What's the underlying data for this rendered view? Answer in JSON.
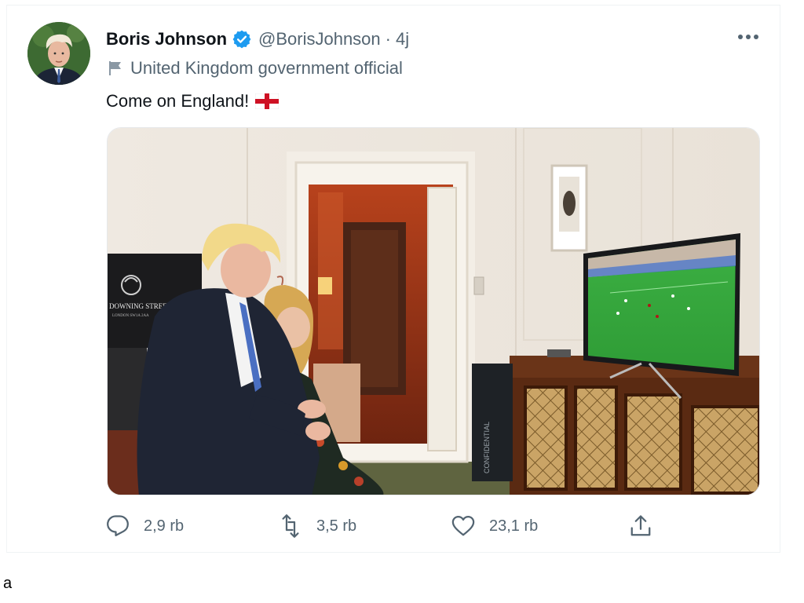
{
  "tweet": {
    "display_name": "Boris Johnson",
    "handle": "@BorisJohnson",
    "separator": "·",
    "timestamp": "4j",
    "label": "United Kingdom government official",
    "text": "Come on England!",
    "more_icon": "more-horizontal-icon",
    "verified_color": "#1d9bf0",
    "photo": {
      "sign_text": "DOWNING STREET",
      "sign_subtext": "LONDON SW1A 2AA",
      "cabinet_text": "CONFIDENTIAL"
    },
    "actions": {
      "reply": {
        "icon": "reply-icon",
        "count": "2,9 rb"
      },
      "retweet": {
        "icon": "retweet-icon",
        "count": "3,5 rb"
      },
      "like": {
        "icon": "heart-icon",
        "count": "23,1 rb"
      },
      "share": {
        "icon": "share-icon"
      }
    }
  },
  "footer_text": "a",
  "colors": {
    "text_primary": "#0f1419",
    "text_secondary": "#536471",
    "accent": "#1d9bf0",
    "england_red": "#ce1124"
  }
}
